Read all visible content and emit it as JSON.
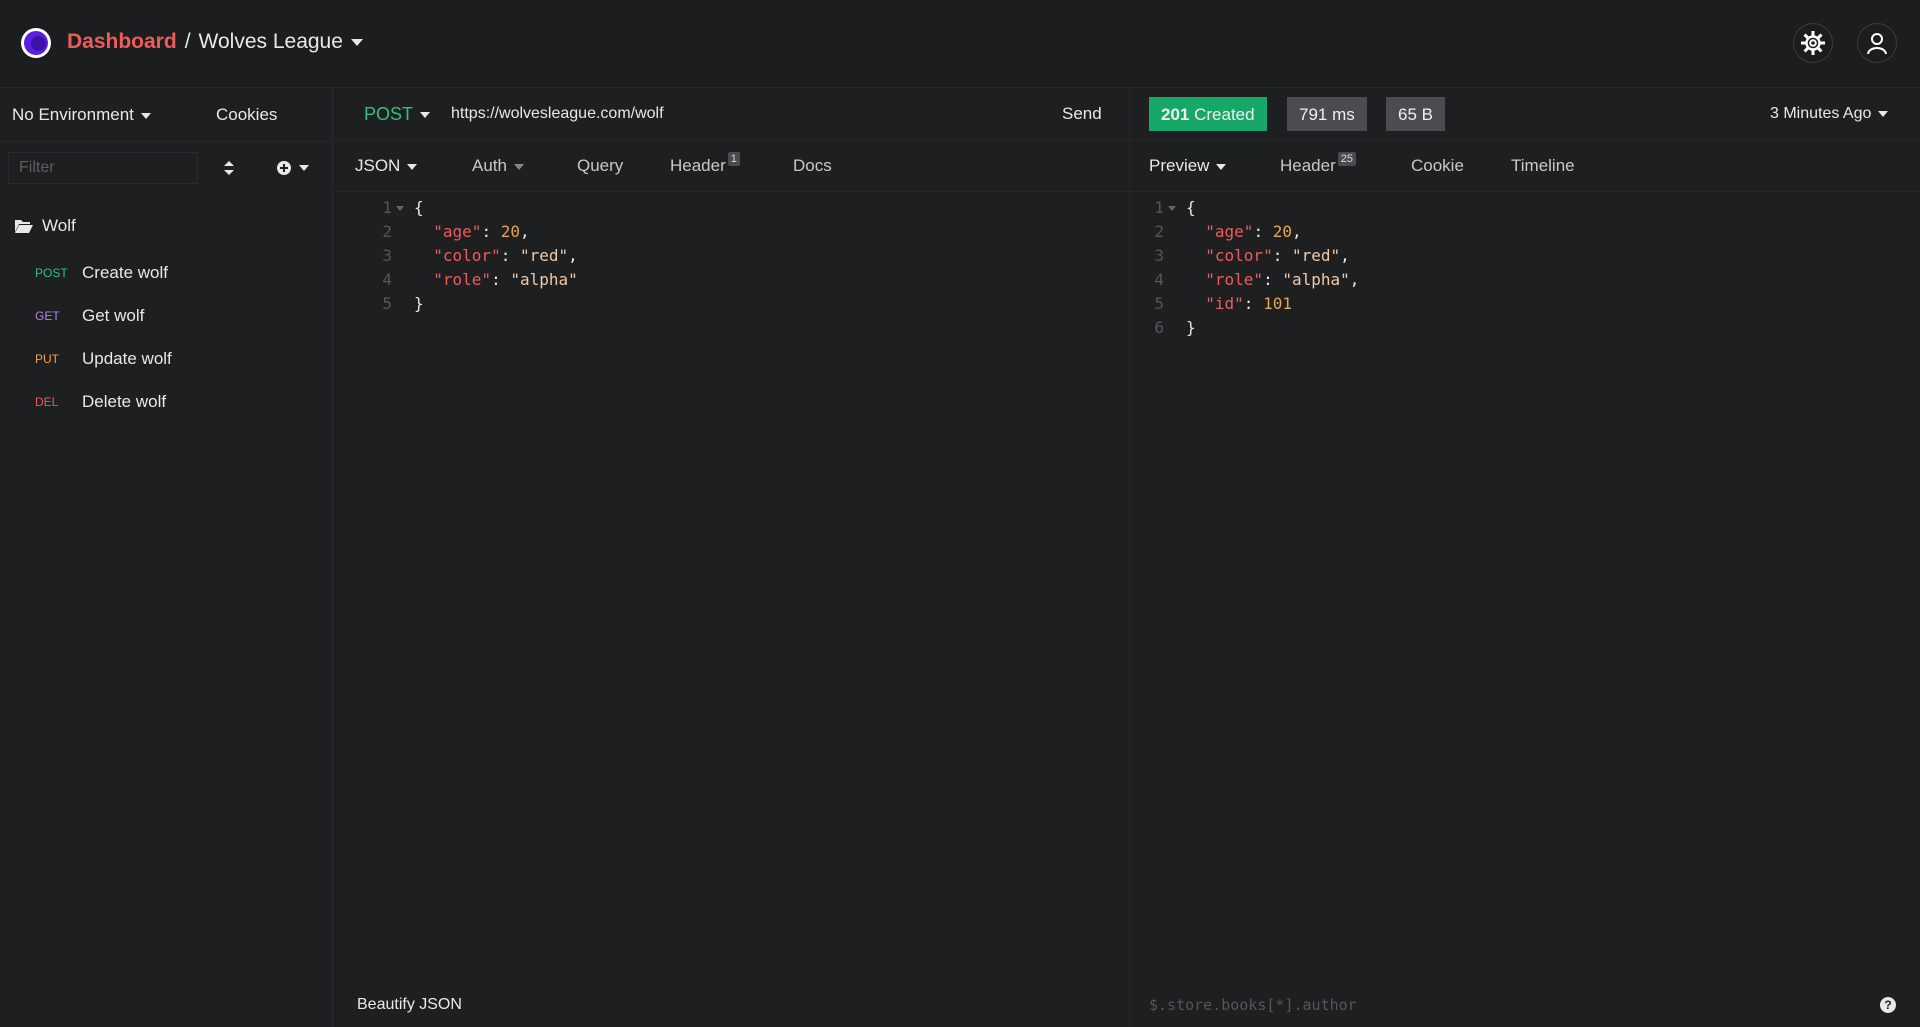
{
  "header": {
    "breadcrumb_dashboard": "Dashboard",
    "breadcrumb_sep": "/",
    "workspace": "Wolves League"
  },
  "sidebar": {
    "environment": "No Environment",
    "cookies": "Cookies",
    "filter_placeholder": "Filter",
    "folder": "Wolf",
    "requests": [
      {
        "method": "POST",
        "name": "Create wolf",
        "color": "#2ec27e"
      },
      {
        "method": "GET",
        "name": "Get wolf",
        "color": "#b57ff0"
      },
      {
        "method": "PUT",
        "name": "Update wolf",
        "color": "#f0a04a"
      },
      {
        "method": "DEL",
        "name": "Delete wolf",
        "color": "#ef5a5a"
      }
    ]
  },
  "request": {
    "method": "POST",
    "url": "https://wolvesleague.com/wolf",
    "send": "Send",
    "tabs": {
      "body": "JSON",
      "auth": "Auth",
      "query": "Query",
      "header": "Header",
      "header_count": "1",
      "docs": "Docs"
    },
    "beautify": "Beautify JSON"
  },
  "response": {
    "status": "201 Created",
    "status_code": "201",
    "status_text": "Created",
    "time": "791 ms",
    "size": "65 B",
    "ago": "3 Minutes Ago",
    "tabs": {
      "preview": "Preview",
      "header": "Header",
      "header_count": "25",
      "cookie": "Cookie",
      "timeline": "Timeline"
    },
    "jsonpath_placeholder": "$.store.books[*].author",
    "help": "?"
  },
  "colors": {
    "accent": "#ef5a5a",
    "success": "#17a869",
    "background": "#1e1f21"
  }
}
